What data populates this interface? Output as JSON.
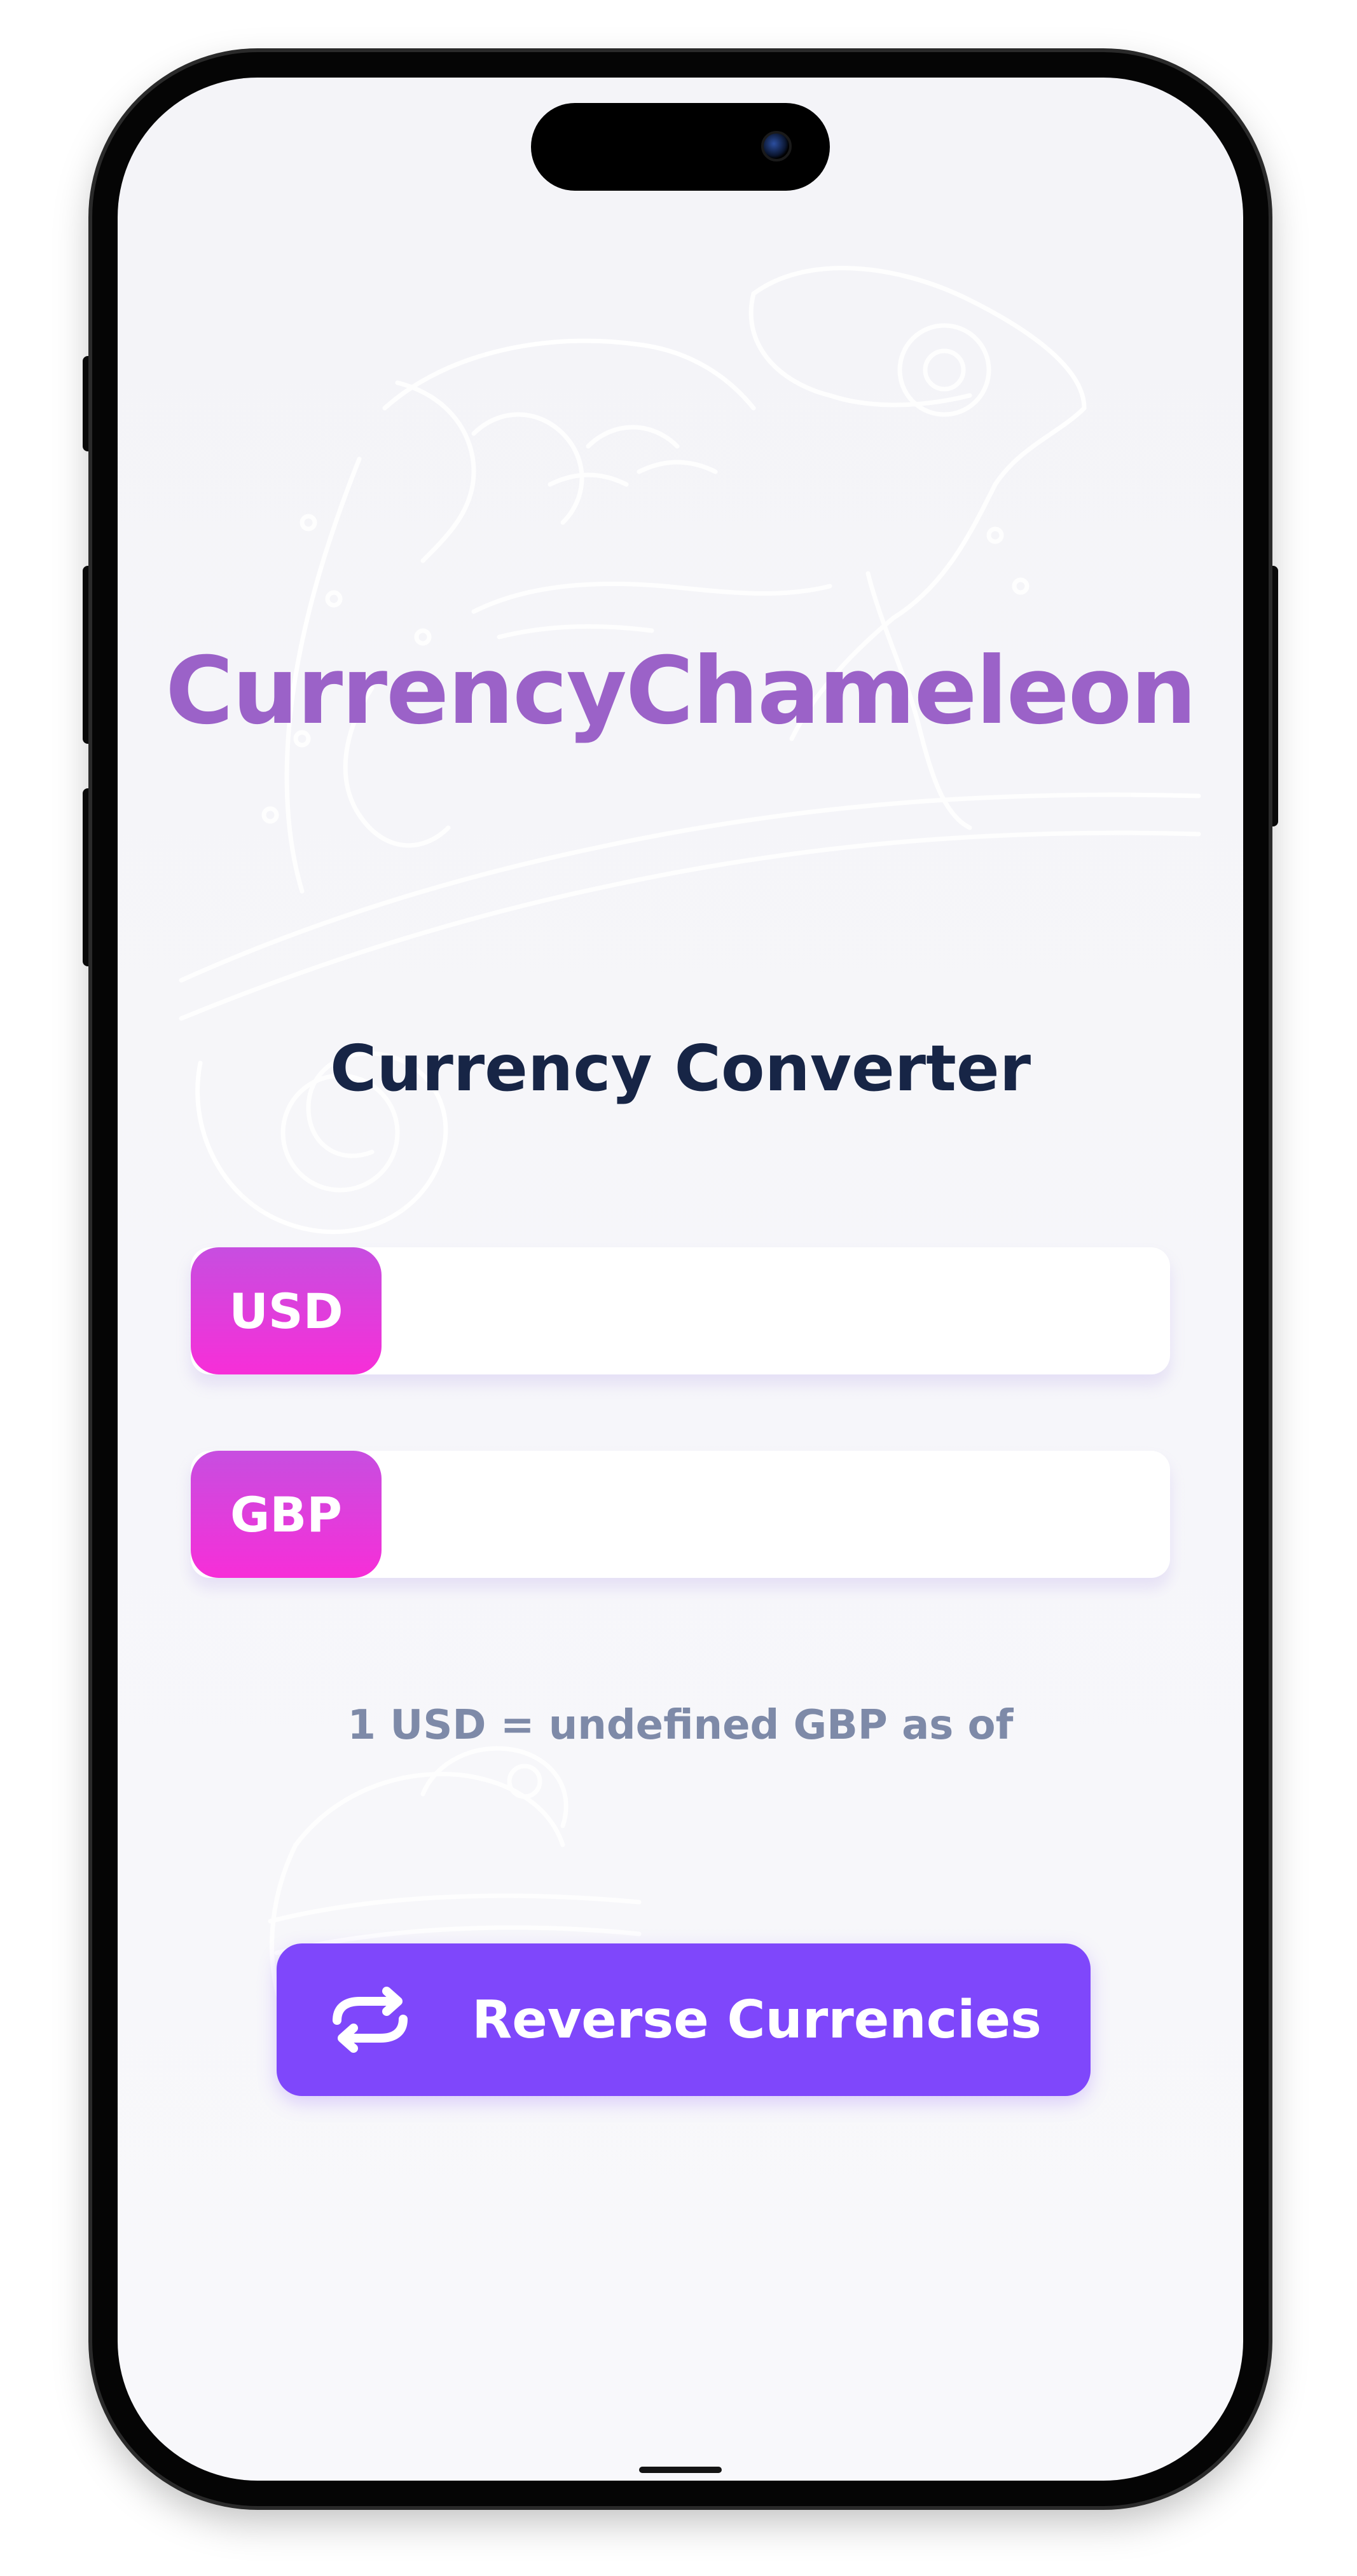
{
  "app": {
    "title": "CurrencyChameleon"
  },
  "converter": {
    "heading": "Currency Converter",
    "from": {
      "currency": "USD",
      "value": "",
      "placeholder": ""
    },
    "to": {
      "currency": "GBP",
      "value": "",
      "placeholder": ""
    },
    "rate_text": "1 USD = undefined GBP as of",
    "reverse_button_label": "Reverse Currencies",
    "reverse_icon": "swap-arrows-icon"
  },
  "colors": {
    "title": "#9b62c8",
    "heading": "#172546",
    "currency_tag_gradient_start": "#c74ee0",
    "currency_tag_gradient_end": "#f72ed8",
    "rate_text": "#7e8aa8",
    "reverse_button": "#7f47fb",
    "screen_background": "#f4f4f8"
  }
}
